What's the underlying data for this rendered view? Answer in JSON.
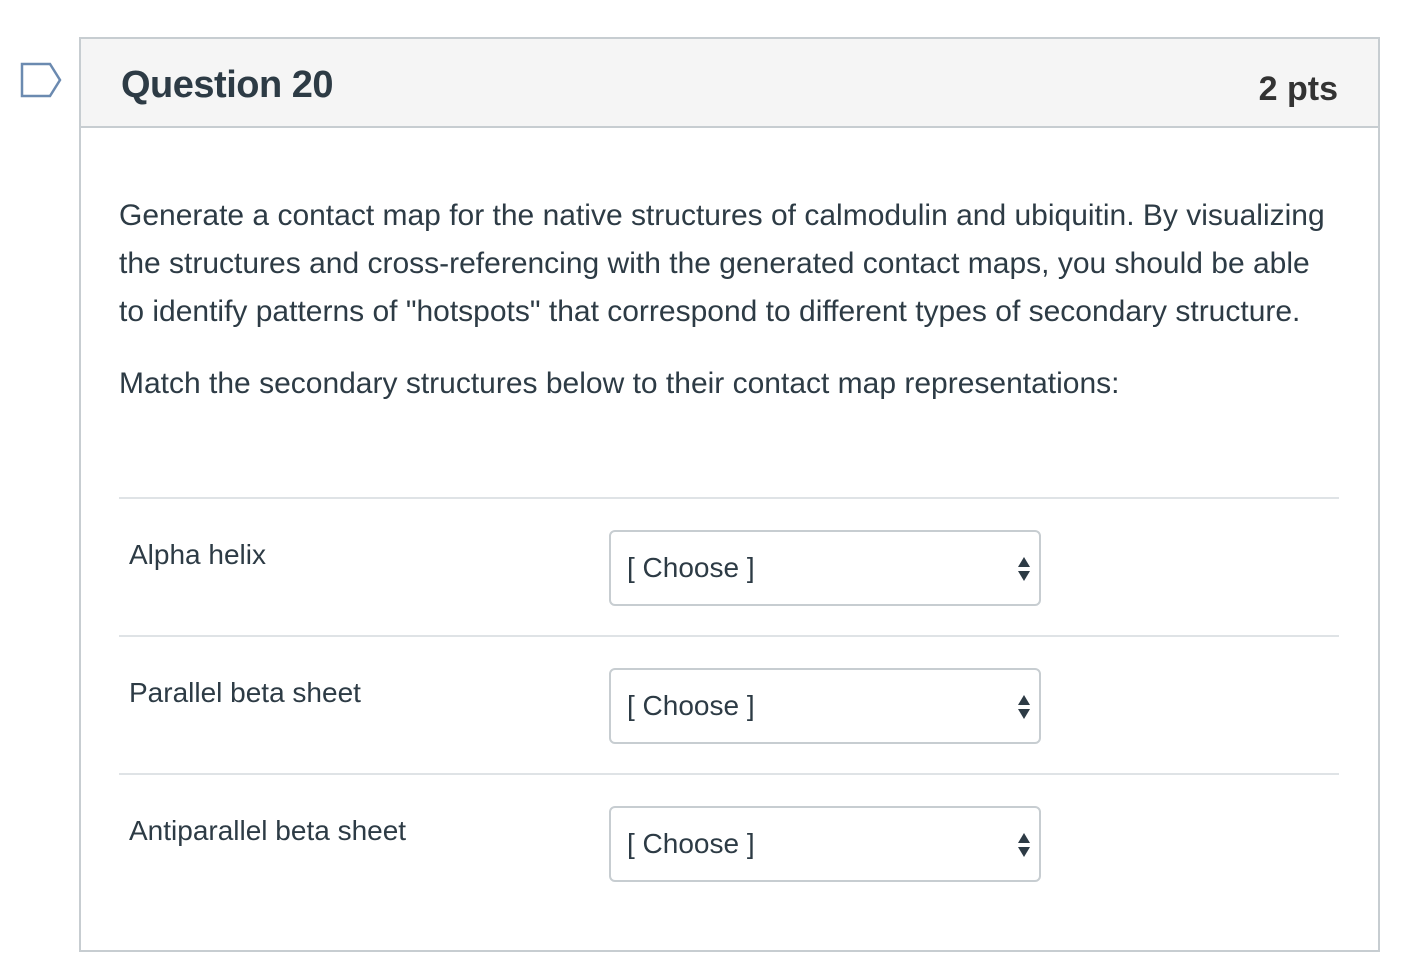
{
  "question": {
    "title": "Question 20",
    "points": "2 pts",
    "text": "Generate a contact map for the native structures of calmodulin and ubiquitin. By visualizing the structures and cross-referencing with the generated contact maps, you should be able to identify patterns of \"hotspots\" that correspond to different types of secondary structure.",
    "instruction": "Match the secondary structures below to their contact map representations:"
  },
  "answers": [
    {
      "label": "Alpha helix",
      "selected": "[ Choose ]"
    },
    {
      "label": "Parallel beta sheet",
      "selected": "[ Choose ]"
    },
    {
      "label": "Antiparallel beta sheet",
      "selected": "[ Choose ]"
    }
  ],
  "icons": {
    "flag": "flag-question-icon",
    "select_arrows": "up-down-arrows-icon"
  },
  "colors": {
    "border": "#c7cdd1",
    "header_bg": "#f5f5f5",
    "text": "#2d3b45",
    "flag": "#6b8ab0"
  }
}
